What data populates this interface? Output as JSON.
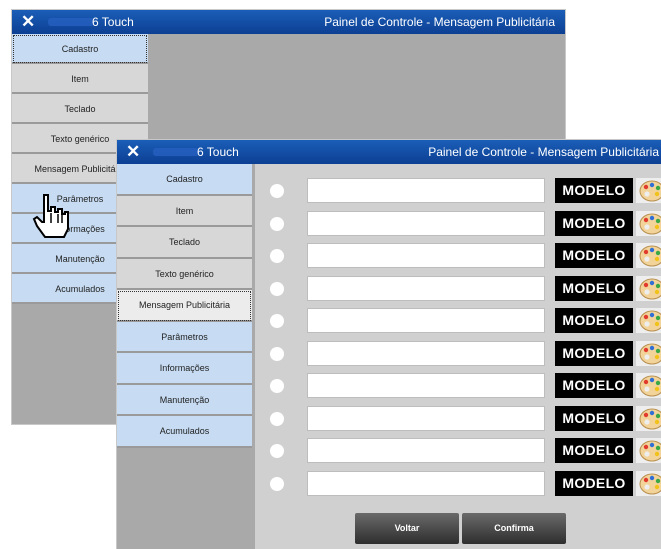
{
  "window_back": {
    "close_glyph": "✕",
    "app_name": "6 Touch",
    "title": "Painel de Controle - Mensagem Publicitária",
    "menu": [
      "Cadastro",
      "Item",
      "Teclado",
      "Texto genérico",
      "Mensagem Publicitária",
      "Parâmetros",
      "Informações",
      "Manutenção",
      "Acumulados"
    ]
  },
  "window_front": {
    "close_glyph": "✕",
    "app_name": "6 Touch",
    "title": "Painel de Controle - Mensagem Publicitária",
    "menu": [
      "Cadastro",
      "Item",
      "Teclado",
      "Texto genérico",
      "Mensagem Publicitária",
      "Parâmetros",
      "Informações",
      "Manutenção",
      "Acumulados"
    ],
    "selected_menu": "Mensagem Publicitária",
    "rows": [
      {
        "model_label": "MODELO",
        "text": ""
      },
      {
        "model_label": "MODELO",
        "text": ""
      },
      {
        "model_label": "MODELO",
        "text": ""
      },
      {
        "model_label": "MODELO",
        "text": ""
      },
      {
        "model_label": "MODELO",
        "text": ""
      },
      {
        "model_label": "MODELO",
        "text": ""
      },
      {
        "model_label": "MODELO",
        "text": ""
      },
      {
        "model_label": "MODELO",
        "text": ""
      },
      {
        "model_label": "MODELO",
        "text": ""
      },
      {
        "model_label": "MODELO",
        "text": ""
      }
    ],
    "buttons": {
      "back": "Voltar",
      "confirm": "Confirma"
    }
  },
  "colors": {
    "titlebar": "#0c3f93",
    "menu_blue": "#c7dcf3",
    "menu_gray": "#d7d7d7",
    "modelo_bg": "#000000"
  },
  "icons": [
    "close-icon",
    "palette-icon",
    "hand-pointer-cursor-icon"
  ]
}
